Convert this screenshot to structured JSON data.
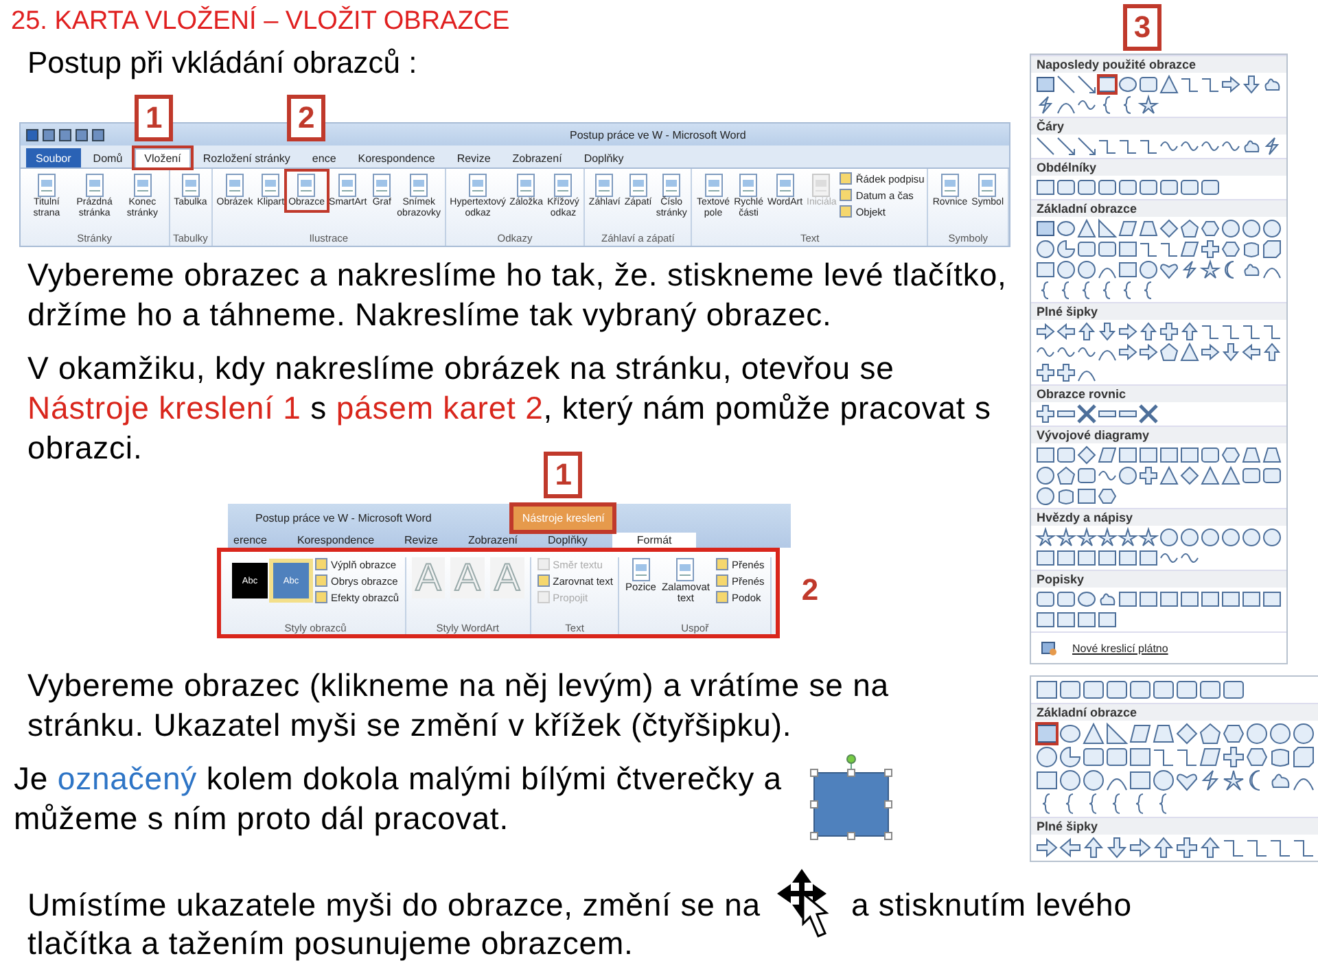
{
  "slide_title": "25. KARTA VLOŽENÍ – VLOŽIT OBRAZCE",
  "subtitle": "Postup při vkládání obrazců :",
  "ribbon_insert": {
    "window_title": "Postup práce ve W - Microsoft Word",
    "tabs": [
      {
        "label": "Soubor",
        "kind": "file",
        "selected": false
      },
      {
        "label": "Domů",
        "kind": "tab",
        "selected": false
      },
      {
        "label": "Vložení",
        "kind": "tab",
        "selected": true,
        "callout": "1"
      },
      {
        "label": "Rozložení stránky",
        "kind": "tab",
        "selected": false
      },
      {
        "label": "ence",
        "kind": "tab",
        "selected": false
      },
      {
        "label": "Korespondence",
        "kind": "tab",
        "selected": false
      },
      {
        "label": "Revize",
        "kind": "tab",
        "selected": false
      },
      {
        "label": "Zobrazení",
        "kind": "tab",
        "selected": false
      },
      {
        "label": "Doplňky",
        "kind": "tab",
        "selected": false
      }
    ],
    "groups": [
      {
        "label": "Stránky",
        "buttons": [
          {
            "label": "Titulní strana",
            "kind": "large",
            "disabled": false
          },
          {
            "label": "Prázdná stránka",
            "kind": "large",
            "disabled": false
          },
          {
            "label": "Konec stránky",
            "kind": "large",
            "disabled": false
          }
        ]
      },
      {
        "label": "Tabulky",
        "buttons": [
          {
            "label": "Tabulka",
            "kind": "large",
            "disabled": false
          }
        ]
      },
      {
        "label": "Ilustrace",
        "buttons": [
          {
            "label": "Obrázek",
            "kind": "large",
            "disabled": false
          },
          {
            "label": "Klipart",
            "kind": "large",
            "disabled": false
          },
          {
            "label": "Obrazce",
            "kind": "large",
            "disabled": false,
            "callout": "2"
          },
          {
            "label": "SmartArt",
            "kind": "large",
            "disabled": false
          },
          {
            "label": "Graf",
            "kind": "large",
            "disabled": false
          },
          {
            "label": "Snímek obrazovky",
            "kind": "large",
            "disabled": false
          }
        ]
      },
      {
        "label": "Odkazy",
        "buttons": [
          {
            "label": "Hypertextový odkaz",
            "kind": "large",
            "disabled": false
          },
          {
            "label": "Záložka",
            "kind": "large",
            "disabled": false
          },
          {
            "label": "Křížový odkaz",
            "kind": "large",
            "disabled": false
          }
        ]
      },
      {
        "label": "Záhlaví a zápatí",
        "buttons": [
          {
            "label": "Záhlaví",
            "kind": "large",
            "disabled": false
          },
          {
            "label": "Zápatí",
            "kind": "large",
            "disabled": false
          },
          {
            "label": "Číslo stránky",
            "kind": "large",
            "disabled": false
          }
        ]
      },
      {
        "label": "Text",
        "buttons": [
          {
            "label": "Textové pole",
            "kind": "large",
            "disabled": false
          },
          {
            "label": "Rychlé části",
            "kind": "large",
            "disabled": false
          },
          {
            "label": "WordArt",
            "kind": "large",
            "disabled": false
          },
          {
            "label": "Iniciála",
            "kind": "large",
            "disabled": true
          },
          {
            "label": "Řádek podpisu",
            "kind": "small",
            "disabled": false
          },
          {
            "label": "Datum a čas",
            "kind": "small",
            "disabled": false
          },
          {
            "label": "Objekt",
            "kind": "small",
            "disabled": false
          }
        ]
      },
      {
        "label": "Symboly",
        "buttons": [
          {
            "label": "Rovnice",
            "kind": "large",
            "disabled": false
          },
          {
            "label": "Symbol",
            "kind": "large",
            "disabled": false
          }
        ]
      }
    ]
  },
  "paragraph_1": [
    {
      "text": "Vybereme obrazec a nakreslíme ho tak, že. stiskneme levé tlačítko, držíme ho a táhneme. Nakreslíme tak vybraný obrazec.",
      "kind": "plain"
    }
  ],
  "paragraph_2": [
    {
      "text": "V okamžiku, kdy nakreslíme obrázek na stránku, otevřou se ",
      "kind": "plain"
    },
    {
      "text": "Nástroje kreslení 1",
      "kind": "accent"
    },
    {
      "text": " s ",
      "kind": "plain"
    },
    {
      "text": "pásem karet 2",
      "kind": "accent"
    },
    {
      "text": ", který nám pomůže pracovat s obrazci.",
      "kind": "plain"
    }
  ],
  "ribbon_format": {
    "window_title": "Postup práce ve W - Microsoft Word",
    "context_tab": {
      "label": "Nástroje kreslení",
      "callout": "1"
    },
    "tabs": [
      {
        "label": "erence",
        "selected": false
      },
      {
        "label": "Korespondence",
        "selected": false
      },
      {
        "label": "Revize",
        "selected": false
      },
      {
        "label": "Zobrazení",
        "selected": false
      },
      {
        "label": "Doplňky",
        "selected": false
      },
      {
        "label": "Formát",
        "selected": true
      }
    ],
    "groups_callout": "2",
    "groups": [
      {
        "label": "Styly obrazců",
        "swatches": [
          {
            "label": "Abc",
            "color": "#000000",
            "selected": false
          },
          {
            "label": "Abc",
            "color": "#4f81bd",
            "selected": true
          }
        ],
        "buttons": [
          {
            "label": "Výplň obrazce",
            "kind": "small",
            "disabled": false
          },
          {
            "label": "Obrys obrazce",
            "kind": "small",
            "disabled": false
          },
          {
            "label": "Efekty obrazců",
            "kind": "small",
            "disabled": false
          }
        ]
      },
      {
        "label": "Styly WordArt",
        "wordart_samples": [
          "A",
          "A",
          "A"
        ]
      },
      {
        "label": "Text",
        "buttons": [
          {
            "label": "Směr textu",
            "kind": "small",
            "disabled": true
          },
          {
            "label": "Zarovnat text",
            "kind": "small",
            "disabled": false
          },
          {
            "label": "Propojit",
            "kind": "small",
            "disabled": true
          }
        ]
      },
      {
        "label": "Uspoř",
        "buttons": [
          {
            "label": "Pozice",
            "kind": "large",
            "disabled": false
          },
          {
            "label": "Zalamovat text",
            "kind": "large",
            "disabled": false
          },
          {
            "label": "Přenés",
            "kind": "small",
            "disabled": false
          },
          {
            "label": "Přenés",
            "kind": "small",
            "disabled": false
          },
          {
            "label": "Podok",
            "kind": "small",
            "disabled": false
          }
        ]
      }
    ]
  },
  "paragraph_3": [
    {
      "text": "Vybereme obrazec (klikneme na něj levým) a vrátíme se na stránku. Ukazatel myši se změní v křížek (čtyřšipku).",
      "kind": "plain"
    }
  ],
  "paragraph_4": [
    {
      "text": "Je ",
      "kind": "plain"
    },
    {
      "text": "označený",
      "kind": "link"
    },
    {
      "text": " kolem dokola malými bílými čtverečky a můžeme s ním proto dál pracovat.",
      "kind": "plain"
    }
  ],
  "paragraph_5": {
    "before_icon": "Umístíme ukazatele myši do obrazce, změní se na",
    "after_icon": "a stisknutím levého",
    "continuation": "tlačítka a tažením posunujeme obrazcem."
  },
  "gallery_full": {
    "callout": "3",
    "sections": [
      {
        "heading": "Naposledy použité obrazce",
        "kind": "recent",
        "marked": true
      },
      {
        "heading": "Čáry",
        "kind": "lines",
        "marked": false
      },
      {
        "heading": "Obdélníky",
        "kind": "rectangles",
        "marked": false
      },
      {
        "heading": "Základní obrazce",
        "kind": "basic",
        "marked": false
      },
      {
        "heading": "Plné šipky",
        "kind": "arrows",
        "marked": false
      },
      {
        "heading": "Obrazce rovnic",
        "kind": "equation",
        "marked": false
      },
      {
        "heading": "Vývojové diagramy",
        "kind": "flowchart",
        "marked": false
      },
      {
        "heading": "Hvězdy a nápisy",
        "kind": "stars",
        "marked": false
      },
      {
        "heading": "Popisky",
        "kind": "callouts",
        "marked": false
      }
    ],
    "footer": "Nové kreslicí plátno"
  },
  "gallery_detail": {
    "sections": [
      {
        "kind": "rectangles",
        "marked": false
      },
      {
        "heading": "Základní obrazce",
        "kind": "basic",
        "marked": true
      },
      {
        "heading": "Plné šipky",
        "kind": "arrows_row",
        "marked": false
      }
    ]
  }
}
